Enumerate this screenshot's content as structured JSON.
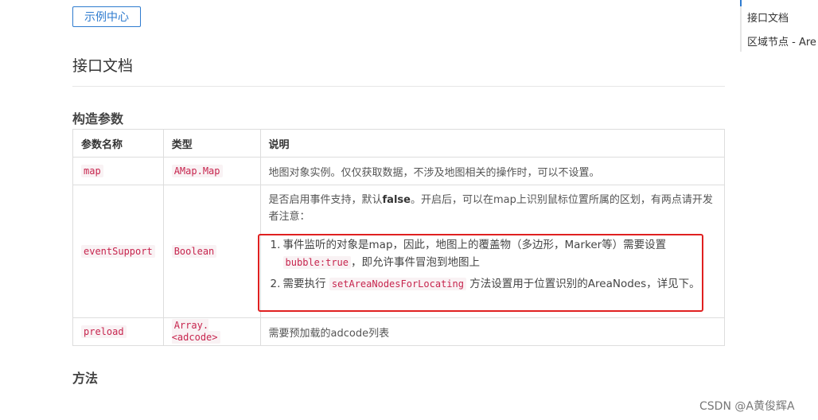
{
  "demo_button": "示例中心",
  "api_title": "接口文档",
  "ctor_title": "构造参数",
  "methods_title": "方法",
  "table": {
    "headers": [
      "参数名称",
      "类型",
      "说明"
    ],
    "rows": [
      {
        "name": "map",
        "type": "AMap.Map",
        "desc": "地图对象实例。仅仅获取数据，不涉及地图相关的操作时，可以不设置。"
      },
      {
        "name": "eventSupport",
        "type": "Boolean",
        "desc_intro": "是否启用事件支持，默认",
        "desc_bold": "false",
        "desc_rest": "。开启后，可以在map上识别鼠标位置所属的区划，有两点请开发者注意：",
        "list": [
          {
            "num": "1.",
            "text_a": "事件监听的对象是map，因此，地图上的覆盖物（多边形，Marker等）需要设置",
            "code": "bubble:true",
            "text_b": "，即允许事件冒泡到地图上"
          },
          {
            "num": "2.",
            "text_a": "需要执行",
            "code": "setAreaNodesForLocating",
            "text_b": "方法设置用于位置识别的AreaNodes，详见下。"
          }
        ]
      },
      {
        "name": "preload",
        "type": "Array.<adcode>",
        "desc": "需要预加载的adcode列表"
      }
    ]
  },
  "toc": [
    "接口文档",
    "区域节点 - Are"
  ],
  "watermark": "CSDN @A黄俊辉A"
}
